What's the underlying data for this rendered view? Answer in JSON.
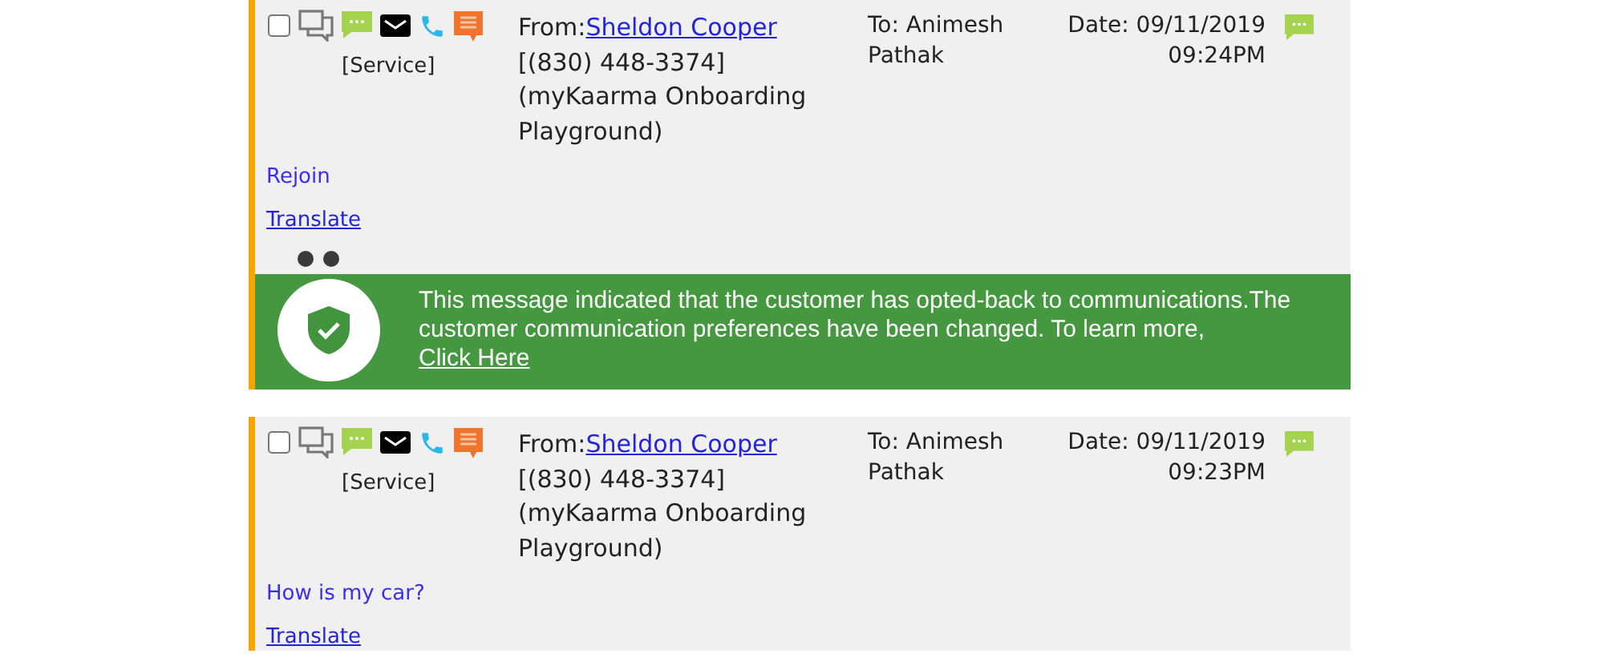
{
  "messages": [
    {
      "checked": false,
      "department": "[Service]",
      "from_label": "From:",
      "from_name": "Sheldon Cooper",
      "from_phone": "[(830) 448-3374]",
      "from_org": "(myKaarma Onboarding Playground)",
      "to": "To: Animesh Pathak",
      "date": "Date: 09/11/2019",
      "time": "09:24PM",
      "body": "Rejoin",
      "translate": "Translate",
      "typing_indicator": true,
      "notice": {
        "text": "This message indicated that the customer has opted-back to communications.The customer communication preferences have been changed. To learn more,",
        "link": "Click Here"
      }
    },
    {
      "checked": false,
      "department": "[Service]",
      "from_label": "From:",
      "from_name": "Sheldon Cooper",
      "from_phone": "[(830) 448-3374]",
      "from_org": "(myKaarma Onboarding Playground)",
      "to": "To: Animesh Pathak",
      "date": "Date: 09/11/2019",
      "time": "09:23PM",
      "body": "How is my car?",
      "translate": "Translate",
      "typing_indicator": false
    }
  ]
}
